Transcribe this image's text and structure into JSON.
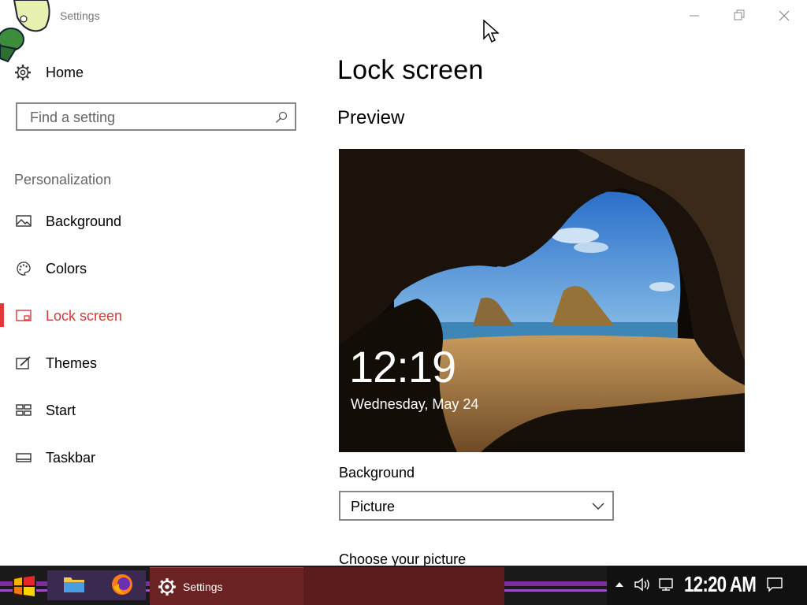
{
  "window": {
    "title": "Settings"
  },
  "sidebar": {
    "home_label": "Home",
    "search_placeholder": "Find a setting",
    "section_title": "Personalization",
    "items": [
      {
        "label": "Background",
        "icon": "picture-icon"
      },
      {
        "label": "Colors",
        "icon": "palette-icon"
      },
      {
        "label": "Lock screen",
        "icon": "lock-screen-icon",
        "active": true
      },
      {
        "label": "Themes",
        "icon": "themes-icon"
      },
      {
        "label": "Start",
        "icon": "start-icon"
      },
      {
        "label": "Taskbar",
        "icon": "taskbar-icon"
      }
    ]
  },
  "main": {
    "title": "Lock screen",
    "preview_heading": "Preview",
    "preview_time": "12:19",
    "preview_date": "Wednesday, May 24",
    "background_label": "Background",
    "background_value": "Picture",
    "choose_picture_label": "Choose your picture"
  },
  "taskbar": {
    "active_app_label": "Settings",
    "clock": "12:20 AM",
    "icons": [
      "start-icon",
      "file-explorer-icon",
      "firefox-icon",
      "settings-gear-icon"
    ],
    "tray_icons": [
      "chevron-up-icon",
      "volume-icon",
      "network-icon",
      "notification-icon"
    ]
  },
  "colors": {
    "accent": "#e2383c",
    "taskbar_purple": "#7a2f9a",
    "taskbar_active": "#6b2222"
  }
}
